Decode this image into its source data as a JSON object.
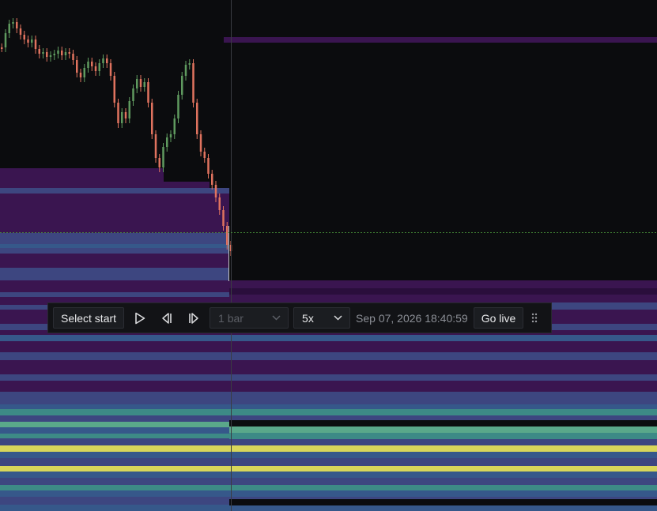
{
  "replay": {
    "select_start_label": "Select start",
    "step_options": [
      "1 bar"
    ],
    "step_selected": "1 bar",
    "speed_selected": "5x",
    "timestamp": "Sep 07, 2026 18:40:59",
    "go_live_label": "Go live"
  },
  "icons": {
    "play": "play-icon",
    "step_back": "step-back-icon",
    "step_forward": "step-forward-icon",
    "dropdown": "chevron-down-icon",
    "drag": "drag-handle-icon"
  },
  "colors": {
    "background": "#0b0c0e",
    "candle_up": "#5f9a5f",
    "candle_down": "#e0735f",
    "heatmap_purple": "#3a1550",
    "heatmap_dark_purple": "#2a0e3c",
    "heatmap_indigo": "#3d4680",
    "heatmap_blue": "#36588a",
    "heatmap_teal": "#3d8a86",
    "heatmap_green": "#5aa88a",
    "heatmap_yellow": "#d8d65a",
    "crosshair_line": "#4b9a3c"
  }
}
